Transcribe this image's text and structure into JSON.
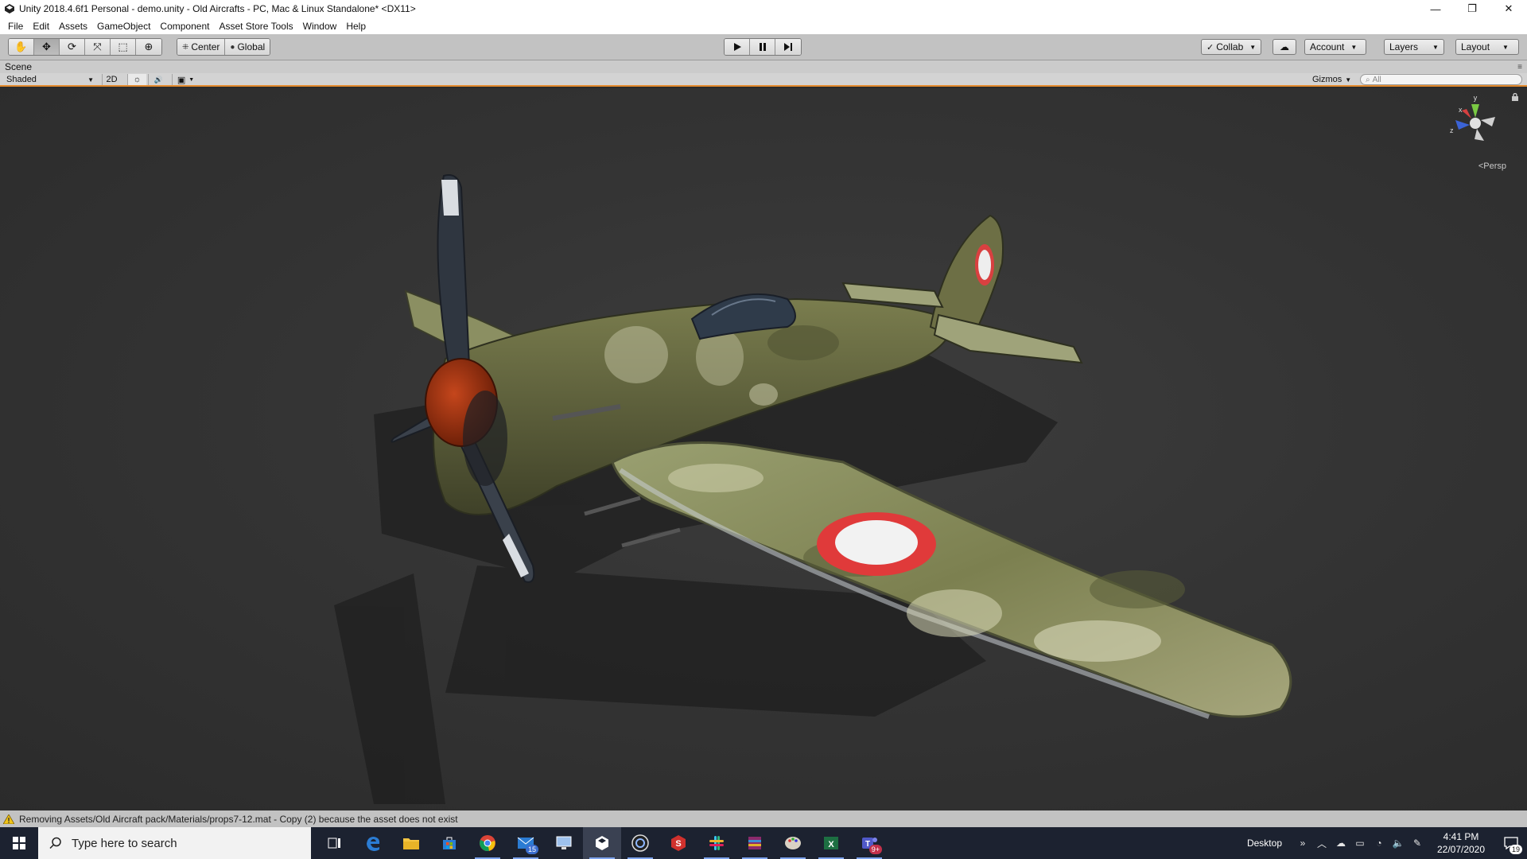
{
  "window": {
    "title": "Unity 2018.4.6f1 Personal - demo.unity - Old Aircrafts - PC, Mac & Linux Standalone* <DX11>",
    "controls": {
      "minimize": "—",
      "maximize": "❐",
      "close": "✕"
    }
  },
  "menu": {
    "items": [
      "File",
      "Edit",
      "Assets",
      "GameObject",
      "Component",
      "Asset Store Tools",
      "Window",
      "Help"
    ]
  },
  "toolbar": {
    "tools": [
      {
        "name": "hand-tool",
        "icon": "✋",
        "active": false
      },
      {
        "name": "move-tool",
        "icon": "✥",
        "active": true
      },
      {
        "name": "rotate-tool",
        "icon": "⟳",
        "active": false
      },
      {
        "name": "scale-tool",
        "icon": "⤧",
        "active": false
      },
      {
        "name": "rect-tool",
        "icon": "⬚",
        "active": false
      },
      {
        "name": "transform-tool",
        "icon": "⊕",
        "active": false
      }
    ],
    "pivot": {
      "icon": "⁜",
      "label": "Center"
    },
    "rotation": {
      "icon": "●",
      "label": "Global"
    },
    "collab": {
      "icon": "✓",
      "label": "Collab"
    },
    "cloud_icon": "☁",
    "account": "Account",
    "layers": "Layers",
    "layout": "Layout"
  },
  "scene": {
    "tab_label": "Scene",
    "shading_mode": "Shaded",
    "mode_2d": "2D",
    "lighting_icon": "☼",
    "audio_icon": "🔊",
    "effects_icon": "▣",
    "gizmos": "Gizmos",
    "search_placeholder": "All",
    "projection": "Persp",
    "axis_labels": {
      "y": "y",
      "x": "x",
      "z": "z"
    }
  },
  "status": {
    "message": "Removing Assets/Old Aircraft pack/Materials/props7-12.mat - Copy (2) because the asset does not exist"
  },
  "taskbar": {
    "search_placeholder": "Type here to search",
    "mail_badge": "15",
    "teams_badge": "9+",
    "desktop_label": "Desktop",
    "time": "4:41 PM",
    "date": "22/07/2020",
    "notification_count": "19"
  },
  "colors": {
    "accent_orange": "#e38a2d",
    "editor_gray": "#c2c2c2",
    "taskbar": "#1c2230"
  }
}
